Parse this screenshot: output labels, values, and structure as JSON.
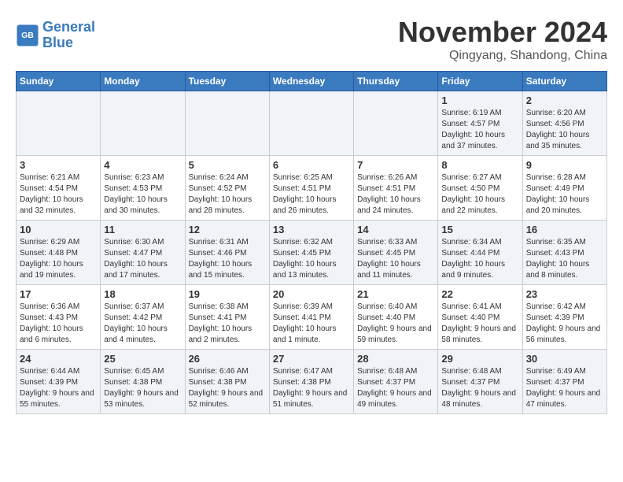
{
  "header": {
    "logo_line1": "General",
    "logo_line2": "Blue",
    "month": "November 2024",
    "location": "Qingyang, Shandong, China"
  },
  "weekdays": [
    "Sunday",
    "Monday",
    "Tuesday",
    "Wednesday",
    "Thursday",
    "Friday",
    "Saturday"
  ],
  "weeks": [
    [
      {
        "day": "",
        "info": ""
      },
      {
        "day": "",
        "info": ""
      },
      {
        "day": "",
        "info": ""
      },
      {
        "day": "",
        "info": ""
      },
      {
        "day": "",
        "info": ""
      },
      {
        "day": "1",
        "info": "Sunrise: 6:19 AM\nSunset: 4:57 PM\nDaylight: 10 hours and 37 minutes."
      },
      {
        "day": "2",
        "info": "Sunrise: 6:20 AM\nSunset: 4:56 PM\nDaylight: 10 hours and 35 minutes."
      }
    ],
    [
      {
        "day": "3",
        "info": "Sunrise: 6:21 AM\nSunset: 4:54 PM\nDaylight: 10 hours and 32 minutes."
      },
      {
        "day": "4",
        "info": "Sunrise: 6:23 AM\nSunset: 4:53 PM\nDaylight: 10 hours and 30 minutes."
      },
      {
        "day": "5",
        "info": "Sunrise: 6:24 AM\nSunset: 4:52 PM\nDaylight: 10 hours and 28 minutes."
      },
      {
        "day": "6",
        "info": "Sunrise: 6:25 AM\nSunset: 4:51 PM\nDaylight: 10 hours and 26 minutes."
      },
      {
        "day": "7",
        "info": "Sunrise: 6:26 AM\nSunset: 4:51 PM\nDaylight: 10 hours and 24 minutes."
      },
      {
        "day": "8",
        "info": "Sunrise: 6:27 AM\nSunset: 4:50 PM\nDaylight: 10 hours and 22 minutes."
      },
      {
        "day": "9",
        "info": "Sunrise: 6:28 AM\nSunset: 4:49 PM\nDaylight: 10 hours and 20 minutes."
      }
    ],
    [
      {
        "day": "10",
        "info": "Sunrise: 6:29 AM\nSunset: 4:48 PM\nDaylight: 10 hours and 19 minutes."
      },
      {
        "day": "11",
        "info": "Sunrise: 6:30 AM\nSunset: 4:47 PM\nDaylight: 10 hours and 17 minutes."
      },
      {
        "day": "12",
        "info": "Sunrise: 6:31 AM\nSunset: 4:46 PM\nDaylight: 10 hours and 15 minutes."
      },
      {
        "day": "13",
        "info": "Sunrise: 6:32 AM\nSunset: 4:45 PM\nDaylight: 10 hours and 13 minutes."
      },
      {
        "day": "14",
        "info": "Sunrise: 6:33 AM\nSunset: 4:45 PM\nDaylight: 10 hours and 11 minutes."
      },
      {
        "day": "15",
        "info": "Sunrise: 6:34 AM\nSunset: 4:44 PM\nDaylight: 10 hours and 9 minutes."
      },
      {
        "day": "16",
        "info": "Sunrise: 6:35 AM\nSunset: 4:43 PM\nDaylight: 10 hours and 8 minutes."
      }
    ],
    [
      {
        "day": "17",
        "info": "Sunrise: 6:36 AM\nSunset: 4:43 PM\nDaylight: 10 hours and 6 minutes."
      },
      {
        "day": "18",
        "info": "Sunrise: 6:37 AM\nSunset: 4:42 PM\nDaylight: 10 hours and 4 minutes."
      },
      {
        "day": "19",
        "info": "Sunrise: 6:38 AM\nSunset: 4:41 PM\nDaylight: 10 hours and 2 minutes."
      },
      {
        "day": "20",
        "info": "Sunrise: 6:39 AM\nSunset: 4:41 PM\nDaylight: 10 hours and 1 minute."
      },
      {
        "day": "21",
        "info": "Sunrise: 6:40 AM\nSunset: 4:40 PM\nDaylight: 9 hours and 59 minutes."
      },
      {
        "day": "22",
        "info": "Sunrise: 6:41 AM\nSunset: 4:40 PM\nDaylight: 9 hours and 58 minutes."
      },
      {
        "day": "23",
        "info": "Sunrise: 6:42 AM\nSunset: 4:39 PM\nDaylight: 9 hours and 56 minutes."
      }
    ],
    [
      {
        "day": "24",
        "info": "Sunrise: 6:44 AM\nSunset: 4:39 PM\nDaylight: 9 hours and 55 minutes."
      },
      {
        "day": "25",
        "info": "Sunrise: 6:45 AM\nSunset: 4:38 PM\nDaylight: 9 hours and 53 minutes."
      },
      {
        "day": "26",
        "info": "Sunrise: 6:46 AM\nSunset: 4:38 PM\nDaylight: 9 hours and 52 minutes."
      },
      {
        "day": "27",
        "info": "Sunrise: 6:47 AM\nSunset: 4:38 PM\nDaylight: 9 hours and 51 minutes."
      },
      {
        "day": "28",
        "info": "Sunrise: 6:48 AM\nSunset: 4:37 PM\nDaylight: 9 hours and 49 minutes."
      },
      {
        "day": "29",
        "info": "Sunrise: 6:48 AM\nSunset: 4:37 PM\nDaylight: 9 hours and 48 minutes."
      },
      {
        "day": "30",
        "info": "Sunrise: 6:49 AM\nSunset: 4:37 PM\nDaylight: 9 hours and 47 minutes."
      }
    ]
  ]
}
